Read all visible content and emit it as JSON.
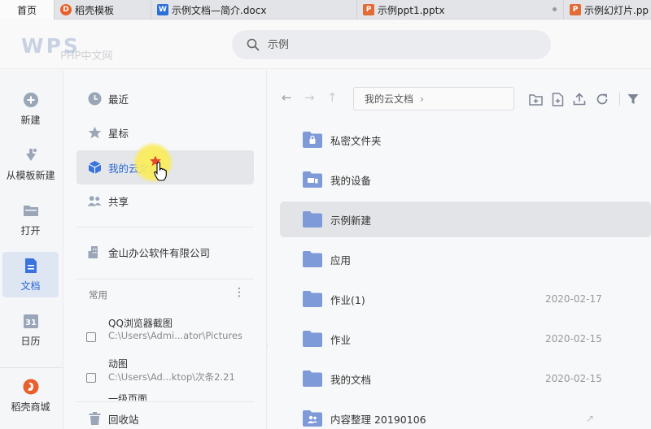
{
  "tabs": [
    {
      "label": "首页",
      "type": "home"
    },
    {
      "label": "稻壳模板",
      "type": "docer"
    },
    {
      "label": "示例文档—简介.docx",
      "type": "word"
    },
    {
      "label": "示例ppt1.pptx",
      "type": "ppt"
    },
    {
      "label": "示例幻灯片.pp",
      "type": "ppt"
    }
  ],
  "header": {
    "logo": "WPS",
    "search_placeholder": "示例"
  },
  "watermarks": [
    "PHP中文网",
    "PHP中文网",
    "PHP中文网"
  ],
  "rail": [
    {
      "label": "新建",
      "icon": "plus-circle-icon"
    },
    {
      "label": "从模板新建",
      "icon": "template-icon"
    },
    {
      "label": "打开",
      "icon": "folder-open-icon"
    },
    {
      "label": "文档",
      "icon": "document-icon",
      "active": true
    },
    {
      "label": "日历",
      "icon": "calendar-icon"
    },
    {
      "label": "稻壳商城",
      "icon": "docer-store-icon"
    }
  ],
  "nav": {
    "items": [
      {
        "label": "最近",
        "icon": "clock-icon"
      },
      {
        "label": "星标",
        "icon": "star-icon"
      },
      {
        "label": "我的云文档",
        "icon": "cloud-doc-icon",
        "active": true
      },
      {
        "label": "共享",
        "icon": "share-people-icon"
      }
    ],
    "company": {
      "label": "金山办公软件有限公司",
      "icon": "building-icon"
    },
    "section_label": "常用",
    "more": "⋮",
    "recent": [
      {
        "title": "QQ浏览器截图",
        "path": "C:\\Users\\Admi...ator\\Pictures"
      },
      {
        "title": "动图",
        "path": "C:\\Users\\Ad...ktop\\次条2.21"
      }
    ],
    "partial": "一级页面",
    "recycle": {
      "label": "回收站",
      "icon": "trash-icon"
    }
  },
  "main": {
    "breadcrumb": "我的云文档",
    "files": [
      {
        "name": "私密文件夹",
        "date": "",
        "icon": "lock-folder-icon"
      },
      {
        "name": "我的设备",
        "date": "",
        "icon": "device-folder-icon"
      },
      {
        "name": "示例新建",
        "date": "",
        "icon": "folder-icon",
        "active": true
      },
      {
        "name": "应用",
        "date": "",
        "icon": "folder-icon"
      },
      {
        "name": "作业(1)",
        "date": "2020-02-17",
        "icon": "folder-icon"
      },
      {
        "name": "作业",
        "date": "2020-02-15",
        "icon": "folder-icon"
      },
      {
        "name": "我的文档",
        "date": "2020-02-15",
        "icon": "folder-icon"
      },
      {
        "name": "内容整理 20190106",
        "date": "",
        "icon": "shared-folder-icon"
      }
    ]
  }
}
